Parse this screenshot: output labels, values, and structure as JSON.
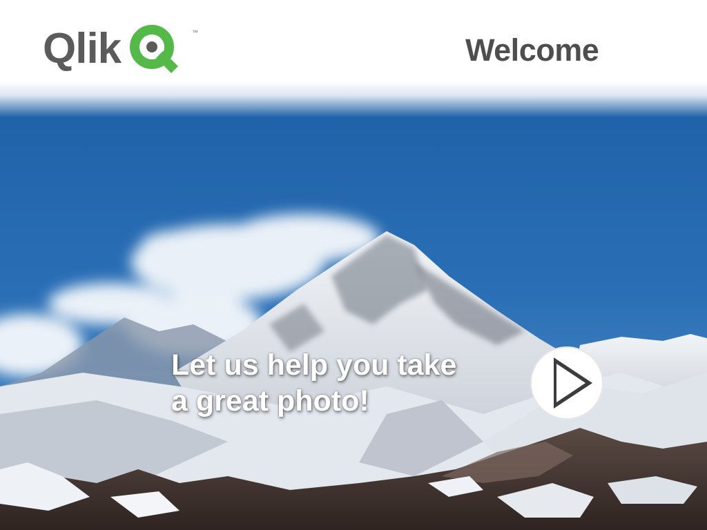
{
  "app": {
    "brand": "Qlik",
    "trademark": "™"
  },
  "header": {
    "title": "Welcome"
  },
  "main": {
    "tagline_line1": "Let us help you take",
    "tagline_line2": "a great photo!",
    "play_icon": "play-icon"
  },
  "colors": {
    "brand_green": "#54b948",
    "brand_gray": "#5b5b5b",
    "sky": "#1d5fa3"
  }
}
